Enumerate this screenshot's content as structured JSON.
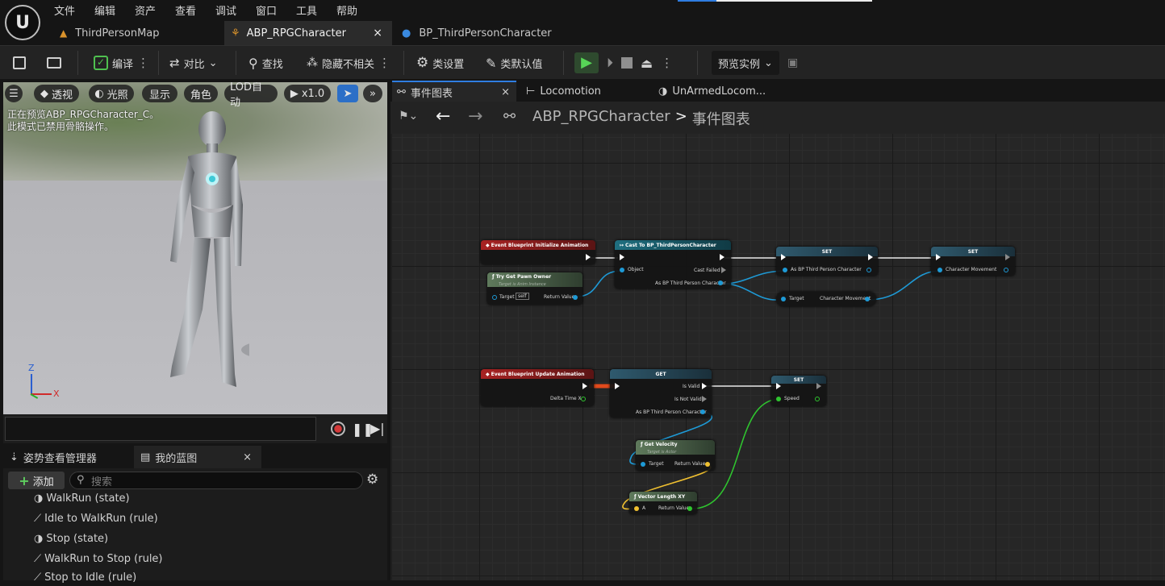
{
  "menu": [
    "文件",
    "编辑",
    "资产",
    "查看",
    "调试",
    "窗口",
    "工具",
    "帮助"
  ],
  "doc_tabs": [
    "ThirdPersonMap",
    "ABP_RPGCharacter",
    "BP_ThirdPersonCharacter"
  ],
  "close_glyph": "×",
  "toolbar": {
    "compile": "编译",
    "diff": "对比",
    "find": "查找",
    "hide_unrelated": "隐藏不相关",
    "class_settings": "类设置",
    "class_defaults": "类默认值",
    "preview_instance": "预览实例"
  },
  "viewport": {
    "buttons": [
      "透视",
      "光照",
      "显示",
      "角色",
      "LOD自动",
      "x1.0"
    ],
    "note_line1": "正在预览ABP_RPGCharacter_C。",
    "note_line2": "此模式已禁用骨骼操作。",
    "axis_x": "X",
    "axis_z": "Z"
  },
  "panel": {
    "tab_pose": "姿势查看管理器",
    "tab_blueprint": "我的蓝图",
    "add": "添加",
    "search_placeholder": "搜索",
    "items": [
      "WalkRun (state)",
      "Idle to WalkRun (rule)",
      "Stop (state)",
      "WalkRun to Stop (rule)",
      "Stop to Idle (rule)"
    ]
  },
  "graph_tabs": [
    "事件图表",
    "Locomotion",
    "UnArmedLocom..."
  ],
  "breadcrumb": {
    "root": "ABP_RPGCharacter",
    "sep": ">",
    "current": "事件图表"
  },
  "nodes": {
    "init_event": "Event Blueprint Initialize Animation",
    "try_get_pawn": "Try Get Pawn Owner",
    "try_get_pawn_sub": "Target is Anim Instance",
    "target": "Target",
    "self": "self",
    "return_value": "Return Value",
    "cast": "Cast To BP_ThirdPersonCharacter",
    "object": "Object",
    "cast_failed": "Cast Failed",
    "as_bp": "As BP Third Person Character",
    "set": "SET",
    "char_movement": "Character Movement",
    "update_event": "Event Blueprint Update Animation",
    "delta_time": "Delta Time X",
    "get": "GET",
    "is_valid": "Is Valid",
    "is_not_valid": "Is Not Valid",
    "speed": "Speed",
    "get_velocity": "Get Velocity",
    "get_velocity_sub": "Target is Actor",
    "vector_length": "Vector Length XY",
    "a": "A"
  },
  "colors": {
    "event_header": "#8a1a1a",
    "pure_header": "#4f6b4d",
    "cast_header": "#1f5f6e",
    "var_header": "#3a5a6a",
    "object_pin": "#1e9ad6",
    "float_pin": "#2fc42f",
    "vector_pin": "#f0c030",
    "accent": "#2f7de1"
  }
}
